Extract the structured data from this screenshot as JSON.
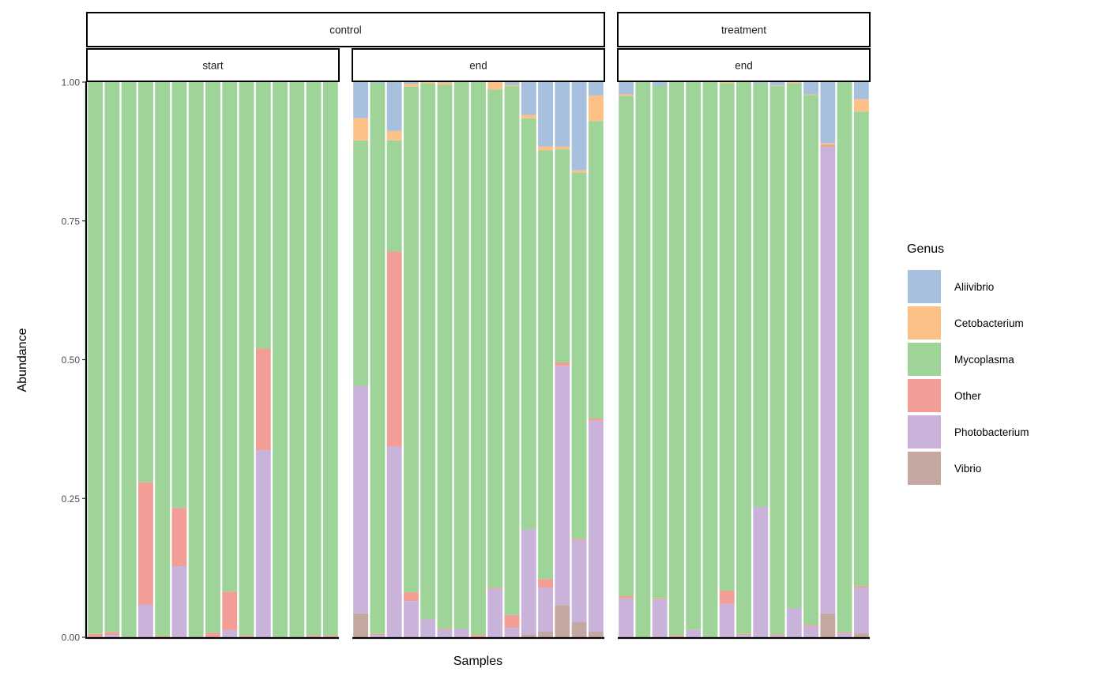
{
  "chart_data": {
    "type": "bar",
    "stacked": true,
    "title": "",
    "xlabel": "Samples",
    "ylabel": "Abundance",
    "ylim": [
      0,
      1
    ],
    "yticks": [
      0,
      0.25,
      0.5,
      0.75,
      1
    ],
    "ytick_labels": [
      "0.00",
      "0.25",
      "0.50",
      "0.75",
      "1.00"
    ],
    "legend": {
      "title": "Genus",
      "placement": "right",
      "entries": [
        {
          "name": "Aliivibrio",
          "color": "#A6C0DE"
        },
        {
          "name": "Cetobacterium",
          "color": "#FDC086"
        },
        {
          "name": "Mycoplasma",
          "color": "#9ED497"
        },
        {
          "name": "Other",
          "color": "#F29E97"
        },
        {
          "name": "Photobacterium",
          "color": "#C9B3DB"
        },
        {
          "name": "Vibrio",
          "color": "#C4A7A1"
        }
      ]
    },
    "stack_order_bottom_to_top": [
      "Vibrio",
      "Photobacterium",
      "Other",
      "Mycoplasma",
      "Cetobacterium",
      "Aliivibrio"
    ],
    "facet_groups": [
      {
        "label": "control",
        "panels": [
          "start",
          "end"
        ]
      },
      {
        "label": "treatment",
        "panels": [
          "end"
        ]
      }
    ],
    "panels": [
      {
        "group": "control",
        "label": "start",
        "samples": [
          {
            "Vibrio": 0,
            "Photobacterium": 0,
            "Other": 0.006,
            "Mycoplasma": 0.994,
            "Cetobacterium": 0,
            "Aliivibrio": 0
          },
          {
            "Vibrio": 0,
            "Photobacterium": 0.004,
            "Other": 0.005,
            "Mycoplasma": 0.991,
            "Cetobacterium": 0,
            "Aliivibrio": 0
          },
          {
            "Vibrio": 0,
            "Photobacterium": 0,
            "Other": 0,
            "Mycoplasma": 1.0,
            "Cetobacterium": 0,
            "Aliivibrio": 0
          },
          {
            "Vibrio": 0,
            "Photobacterium": 0.059,
            "Other": 0.22,
            "Mycoplasma": 0.721,
            "Cetobacterium": 0,
            "Aliivibrio": 0
          },
          {
            "Vibrio": 0,
            "Photobacterium": 0,
            "Other": 0.002,
            "Mycoplasma": 0.998,
            "Cetobacterium": 0,
            "Aliivibrio": 0
          },
          {
            "Vibrio": 0,
            "Photobacterium": 0.128,
            "Other": 0.105,
            "Mycoplasma": 0.767,
            "Cetobacterium": 0,
            "Aliivibrio": 0
          },
          {
            "Vibrio": 0,
            "Photobacterium": 0,
            "Other": 0,
            "Mycoplasma": 1.0,
            "Cetobacterium": 0,
            "Aliivibrio": 0
          },
          {
            "Vibrio": 0,
            "Photobacterium": 0,
            "Other": 0.008,
            "Mycoplasma": 0.992,
            "Cetobacterium": 0,
            "Aliivibrio": 0
          },
          {
            "Vibrio": 0,
            "Photobacterium": 0.013,
            "Other": 0.069,
            "Mycoplasma": 0.918,
            "Cetobacterium": 0,
            "Aliivibrio": 0
          },
          {
            "Vibrio": 0,
            "Photobacterium": 0,
            "Other": 0.003,
            "Mycoplasma": 0.997,
            "Cetobacterium": 0,
            "Aliivibrio": 0
          },
          {
            "Vibrio": 0,
            "Photobacterium": 0.337,
            "Other": 0.183,
            "Mycoplasma": 0.48,
            "Cetobacterium": 0,
            "Aliivibrio": 0
          },
          {
            "Vibrio": 0,
            "Photobacterium": 0,
            "Other": 0,
            "Mycoplasma": 1.0,
            "Cetobacterium": 0,
            "Aliivibrio": 0
          },
          {
            "Vibrio": 0,
            "Photobacterium": 0,
            "Other": 0,
            "Mycoplasma": 1.0,
            "Cetobacterium": 0,
            "Aliivibrio": 0
          },
          {
            "Vibrio": 0,
            "Photobacterium": 0,
            "Other": 0.003,
            "Mycoplasma": 0.997,
            "Cetobacterium": 0,
            "Aliivibrio": 0
          },
          {
            "Vibrio": 0,
            "Photobacterium": 0,
            "Other": 0.003,
            "Mycoplasma": 0.997,
            "Cetobacterium": 0,
            "Aliivibrio": 0
          }
        ]
      },
      {
        "group": "control",
        "label": "end",
        "samples": [
          {
            "Vibrio": 0.043,
            "Photobacterium": 0.41,
            "Other": 0,
            "Mycoplasma": 0.442,
            "Cetobacterium": 0.04,
            "Aliivibrio": 0.065
          },
          {
            "Vibrio": 0,
            "Photobacterium": 0.004,
            "Other": 0.002,
            "Mycoplasma": 0.992,
            "Cetobacterium": 0,
            "Aliivibrio": 0.002
          },
          {
            "Vibrio": 0,
            "Photobacterium": 0.343,
            "Other": 0.352,
            "Mycoplasma": 0.2,
            "Cetobacterium": 0.017,
            "Aliivibrio": 0.088
          },
          {
            "Vibrio": 0,
            "Photobacterium": 0.065,
            "Other": 0.016,
            "Mycoplasma": 0.911,
            "Cetobacterium": 0.005,
            "Aliivibrio": 0.003
          },
          {
            "Vibrio": 0,
            "Photobacterium": 0.032,
            "Other": 0,
            "Mycoplasma": 0.966,
            "Cetobacterium": 0.002,
            "Aliivibrio": 0
          },
          {
            "Vibrio": 0,
            "Photobacterium": 0.013,
            "Other": 0.002,
            "Mycoplasma": 0.98,
            "Cetobacterium": 0.004,
            "Aliivibrio": 0.001
          },
          {
            "Vibrio": 0,
            "Photobacterium": 0.015,
            "Other": 0,
            "Mycoplasma": 0.985,
            "Cetobacterium": 0,
            "Aliivibrio": 0
          },
          {
            "Vibrio": 0,
            "Photobacterium": 0,
            "Other": 0.004,
            "Mycoplasma": 0.996,
            "Cetobacterium": 0,
            "Aliivibrio": 0
          },
          {
            "Vibrio": 0,
            "Photobacterium": 0.087,
            "Other": 0.002,
            "Mycoplasma": 0.898,
            "Cetobacterium": 0.013,
            "Aliivibrio": 0
          },
          {
            "Vibrio": 0,
            "Photobacterium": 0.017,
            "Other": 0.023,
            "Mycoplasma": 0.953,
            "Cetobacterium": 0.002,
            "Aliivibrio": 0.005
          },
          {
            "Vibrio": 0.005,
            "Photobacterium": 0.189,
            "Other": 0,
            "Mycoplasma": 0.741,
            "Cetobacterium": 0.006,
            "Aliivibrio": 0.059
          },
          {
            "Vibrio": 0.01,
            "Photobacterium": 0.079,
            "Other": 0.016,
            "Mycoplasma": 0.772,
            "Cetobacterium": 0.007,
            "Aliivibrio": 0.116
          },
          {
            "Vibrio": 0.058,
            "Photobacterium": 0.431,
            "Other": 0.006,
            "Mycoplasma": 0.384,
            "Cetobacterium": 0.005,
            "Aliivibrio": 0.116
          },
          {
            "Vibrio": 0.027,
            "Photobacterium": 0.148,
            "Other": 0.002,
            "Mycoplasma": 0.66,
            "Cetobacterium": 0.004,
            "Aliivibrio": 0.159
          },
          {
            "Vibrio": 0.01,
            "Photobacterium": 0.38,
            "Other": 0.004,
            "Mycoplasma": 0.536,
            "Cetobacterium": 0.046,
            "Aliivibrio": 0.024
          }
        ]
      },
      {
        "group": "treatment",
        "label": "end",
        "samples": [
          {
            "Vibrio": 0,
            "Photobacterium": 0.07,
            "Other": 0.004,
            "Mycoplasma": 0.901,
            "Cetobacterium": 0.003,
            "Aliivibrio": 0.022
          },
          {
            "Vibrio": 0,
            "Photobacterium": 0,
            "Other": 0,
            "Mycoplasma": 1.0,
            "Cetobacterium": 0,
            "Aliivibrio": 0
          },
          {
            "Vibrio": 0,
            "Photobacterium": 0.068,
            "Other": 0.002,
            "Mycoplasma": 0.923,
            "Cetobacterium": 0,
            "Aliivibrio": 0.007
          },
          {
            "Vibrio": 0,
            "Photobacterium": 0,
            "Other": 0.003,
            "Mycoplasma": 0.997,
            "Cetobacterium": 0,
            "Aliivibrio": 0
          },
          {
            "Vibrio": 0,
            "Photobacterium": 0.013,
            "Other": 0,
            "Mycoplasma": 0.987,
            "Cetobacterium": 0,
            "Aliivibrio": 0
          },
          {
            "Vibrio": 0,
            "Photobacterium": 0,
            "Other": 0,
            "Mycoplasma": 1.0,
            "Cetobacterium": 0,
            "Aliivibrio": 0
          },
          {
            "Vibrio": 0,
            "Photobacterium": 0.06,
            "Other": 0.024,
            "Mycoplasma": 0.914,
            "Cetobacterium": 0.002,
            "Aliivibrio": 0
          },
          {
            "Vibrio": 0,
            "Photobacterium": 0.004,
            "Other": 0.002,
            "Mycoplasma": 0.994,
            "Cetobacterium": 0,
            "Aliivibrio": 0
          },
          {
            "Vibrio": 0,
            "Photobacterium": 0.235,
            "Other": 0,
            "Mycoplasma": 0.763,
            "Cetobacterium": 0,
            "Aliivibrio": 0.002
          },
          {
            "Vibrio": 0,
            "Photobacterium": 0.003,
            "Other": 0.002,
            "Mycoplasma": 0.988,
            "Cetobacterium": 0.001,
            "Aliivibrio": 0.006
          },
          {
            "Vibrio": 0,
            "Photobacterium": 0.052,
            "Other": 0,
            "Mycoplasma": 0.946,
            "Cetobacterium": 0.002,
            "Aliivibrio": 0
          },
          {
            "Vibrio": 0,
            "Photobacterium": 0.02,
            "Other": 0.002,
            "Mycoplasma": 0.955,
            "Cetobacterium": 0.001,
            "Aliivibrio": 0.022
          },
          {
            "Vibrio": 0.043,
            "Photobacterium": 0.84,
            "Other": 0.004,
            "Mycoplasma": 0.001,
            "Cetobacterium": 0.002,
            "Aliivibrio": 0.11
          },
          {
            "Vibrio": 0,
            "Photobacterium": 0.007,
            "Other": 0.002,
            "Mycoplasma": 0.991,
            "Cetobacterium": 0,
            "Aliivibrio": 0
          },
          {
            "Vibrio": 0.007,
            "Photobacterium": 0.082,
            "Other": 0.003,
            "Mycoplasma": 0.855,
            "Cetobacterium": 0.022,
            "Aliivibrio": 0.031
          }
        ]
      }
    ]
  }
}
